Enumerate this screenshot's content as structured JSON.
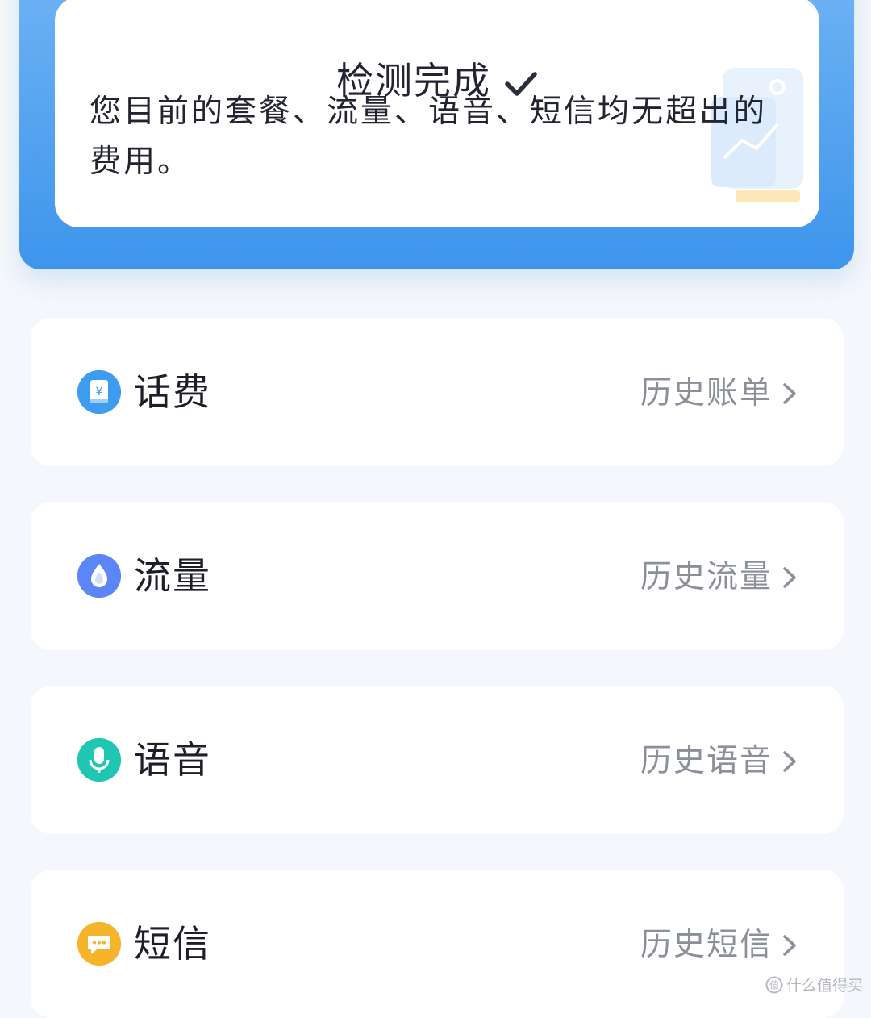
{
  "result": {
    "title": "检测完成",
    "description": "您目前的套餐、流量、语音、短信均无超出的费用。"
  },
  "items": [
    {
      "label": "话费",
      "link": "历史账单",
      "icon": "bill-icon",
      "color": "#3d9bf0"
    },
    {
      "label": "流量",
      "link": "历史流量",
      "icon": "data-drop-icon",
      "color": "#5b86f5"
    },
    {
      "label": "语音",
      "link": "历史语音",
      "icon": "microphone-icon",
      "color": "#1fc7b3"
    },
    {
      "label": "短信",
      "link": "历史短信",
      "icon": "message-icon",
      "color": "#f6b42b"
    }
  ],
  "watermark": "什么值得买",
  "colors": {
    "frame_blue": "#3e95eb",
    "text_dark": "#222531",
    "text_gray": "#8b8f9a"
  }
}
